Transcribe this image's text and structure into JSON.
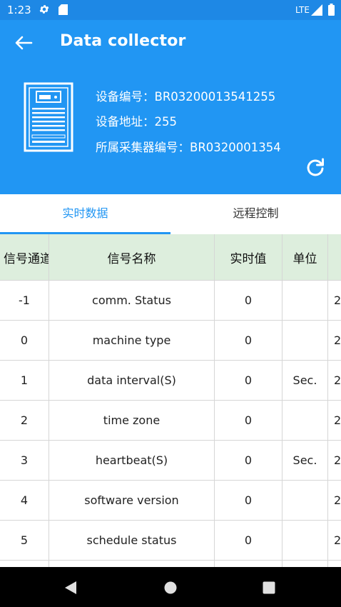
{
  "status_bar": {
    "time": "1:23",
    "network": "LTE"
  },
  "header": {
    "title": "Data collector",
    "device_no": "设备编号：BR03200013541255",
    "device_addr": "设备地址：255",
    "collector_no": "所属采集器编号：BR0320001354"
  },
  "tabs": [
    {
      "label": "实时数据",
      "active": true
    },
    {
      "label": "远程控制",
      "active": false
    }
  ],
  "table": {
    "headers": [
      "信号通道",
      "信号名称",
      "实时值",
      "单位"
    ],
    "rows": [
      {
        "channel": "-1",
        "name": "comm. Status",
        "value": "0",
        "unit": "",
        "extra": "2"
      },
      {
        "channel": "0",
        "name": "machine type",
        "value": "0",
        "unit": "",
        "extra": "2"
      },
      {
        "channel": "1",
        "name": "data interval(S)",
        "value": "0",
        "unit": "Sec.",
        "extra": "2"
      },
      {
        "channel": "2",
        "name": "time zone",
        "value": "0",
        "unit": "",
        "extra": "2"
      },
      {
        "channel": "3",
        "name": "heartbeat(S)",
        "value": "0",
        "unit": "Sec.",
        "extra": "2"
      },
      {
        "channel": "4",
        "name": "software version",
        "value": "0",
        "unit": "",
        "extra": "2"
      },
      {
        "channel": "5",
        "name": "schedule status",
        "value": "0",
        "unit": "",
        "extra": "2"
      }
    ]
  },
  "colors": {
    "primary": "#2196F3",
    "status_bar": "#1E88E5",
    "table_header": "#DDEEDD"
  },
  "icons": [
    "settings-icon",
    "sd-card-icon",
    "signal-icon",
    "battery-icon",
    "back-arrow-icon",
    "device-icon",
    "refresh-icon",
    "nav-back-icon",
    "nav-home-icon",
    "nav-recents-icon"
  ]
}
